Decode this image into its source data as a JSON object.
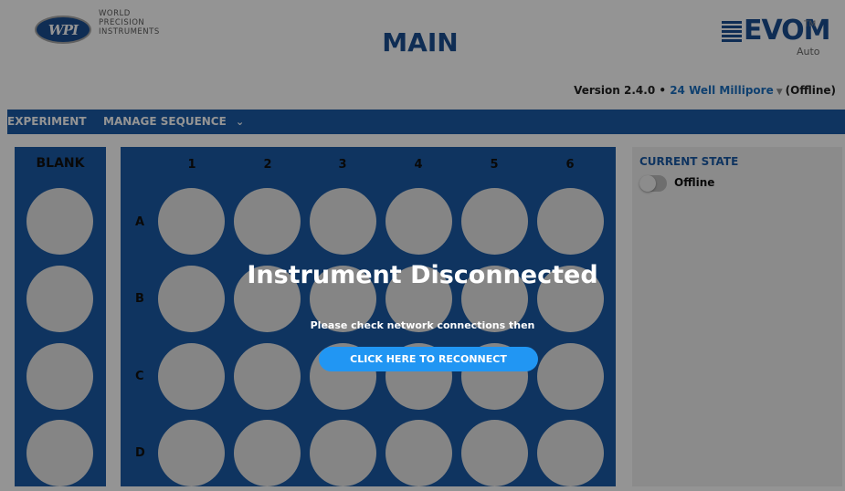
{
  "header": {
    "logo_abbr": "WPI",
    "logo_lines": [
      "WORLD",
      "PRECISION",
      "INSTRUMENTS"
    ],
    "page_title": "MAIN",
    "brand_name": "EVOM",
    "brand_tm": "TM",
    "brand_sub": "Auto",
    "version": "Version 2.4.0 • ",
    "plate_model": "24 Well Millipore",
    "status_suffix": "(Offline)"
  },
  "nav": {
    "experiment": "EXPERIMENT",
    "manage_sequence": "MANAGE SEQUENCE"
  },
  "blank": {
    "label": "BLANK"
  },
  "plate": {
    "columns": [
      "1",
      "2",
      "3",
      "4",
      "5",
      "6"
    ],
    "rows": [
      "A",
      "B",
      "C",
      "D"
    ]
  },
  "state": {
    "title": "CURRENT STATE",
    "value": "Offline"
  },
  "overlay": {
    "title": "Instrument Disconnected",
    "message": "Please check network connections then",
    "button": "CLICK HERE TO RECONNECT"
  },
  "colors": {
    "primary": "#1b5ba6",
    "title_blue": "#1b4f92",
    "button": "#2196f3",
    "well": "#e6e6e6"
  }
}
